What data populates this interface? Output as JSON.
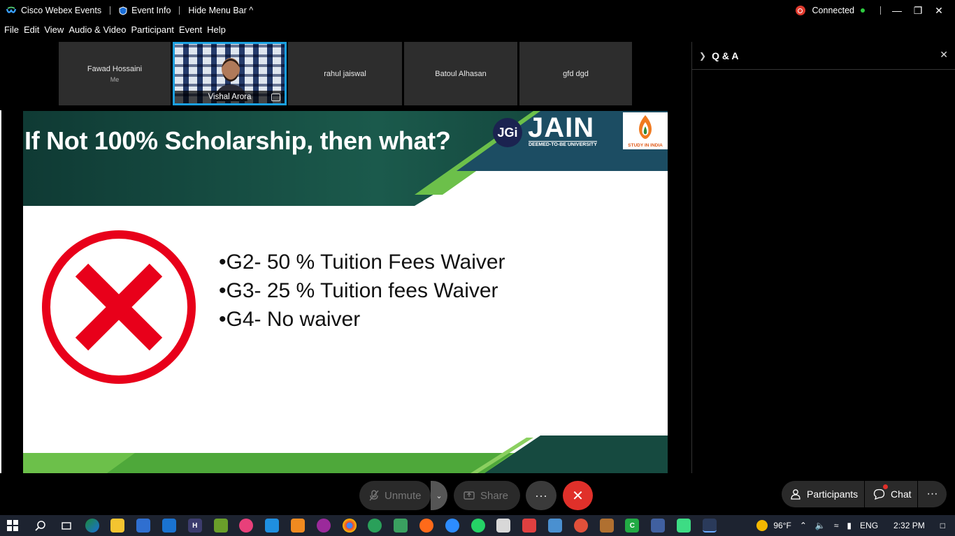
{
  "titlebar": {
    "app_name": "Cisco Webex Events",
    "event_info": "Event Info",
    "hide_menu": "Hide Menu Bar ^",
    "status": "Connected"
  },
  "menu": [
    "File",
    "Edit",
    "View",
    "Audio & Video",
    "Participant",
    "Event",
    "Help"
  ],
  "participants_strip": [
    {
      "name": "Fawad Hossaini",
      "sub": "Me"
    },
    {
      "name": "Vishal Arora"
    },
    {
      "name": "rahul jaiswal"
    },
    {
      "name": "Batoul Alhasan"
    },
    {
      "name": "gfd dgd"
    }
  ],
  "slide": {
    "title": "If Not 100% Scholarship, then what?",
    "logo_jgi": "JGi",
    "logo_jain": "JAIN",
    "logo_jain_sub": "DEEMED-TO-BE UNIVERSITY",
    "logo_sii": "STUDY IN INDIA",
    "bullets": [
      "•G2- 50 % Tuition Fees Waiver",
      "•G3- 25 % Tuition fees Waiver",
      "•G4- No waiver"
    ]
  },
  "qa_panel": {
    "title": "Q & A"
  },
  "controls": {
    "unmute": "Unmute",
    "share": "Share",
    "participants": "Participants",
    "chat": "Chat"
  },
  "taskbar": {
    "weather": "96°F",
    "lang": "ENG",
    "time": "2:32 PM"
  },
  "colors": {
    "accent_blue": "#1ba0e0",
    "leave_red": "#e0302a",
    "slide_green": "#6cc04a",
    "slide_teal": "#164a40"
  }
}
